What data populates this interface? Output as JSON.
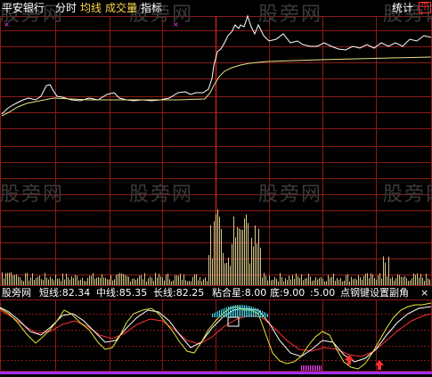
{
  "topbar": {
    "stock_name": "平安银行",
    "tab_timeshare": "分时",
    "tab_avg_line": "均线",
    "tab_volume": "成交量",
    "tab_indicator": "指标",
    "stats_label": "统计",
    "corner_badge": "平"
  },
  "watermark": "股旁网",
  "indicator": {
    "source": "股旁网",
    "short_line": "短线:82.34",
    "mid_line": "中线:85.35",
    "long_line": "长线:82.25",
    "stick_star": "粘合星:8.00",
    "bottom": "底:9.00",
    "extra": ":5.00",
    "signal": "点钢键设置副角"
  },
  "marks": {
    "left_x": "×",
    "mid_x": "×",
    "ind_close": "×"
  },
  "colors": {
    "grid": "#8b1a1a",
    "price": "#ffffff",
    "avg": "#e8e08a",
    "volume": "#d8c888",
    "short": "#e8e840",
    "mid": "#ffffff",
    "long": "#ff3030",
    "accent": "#ff40ff"
  }
}
